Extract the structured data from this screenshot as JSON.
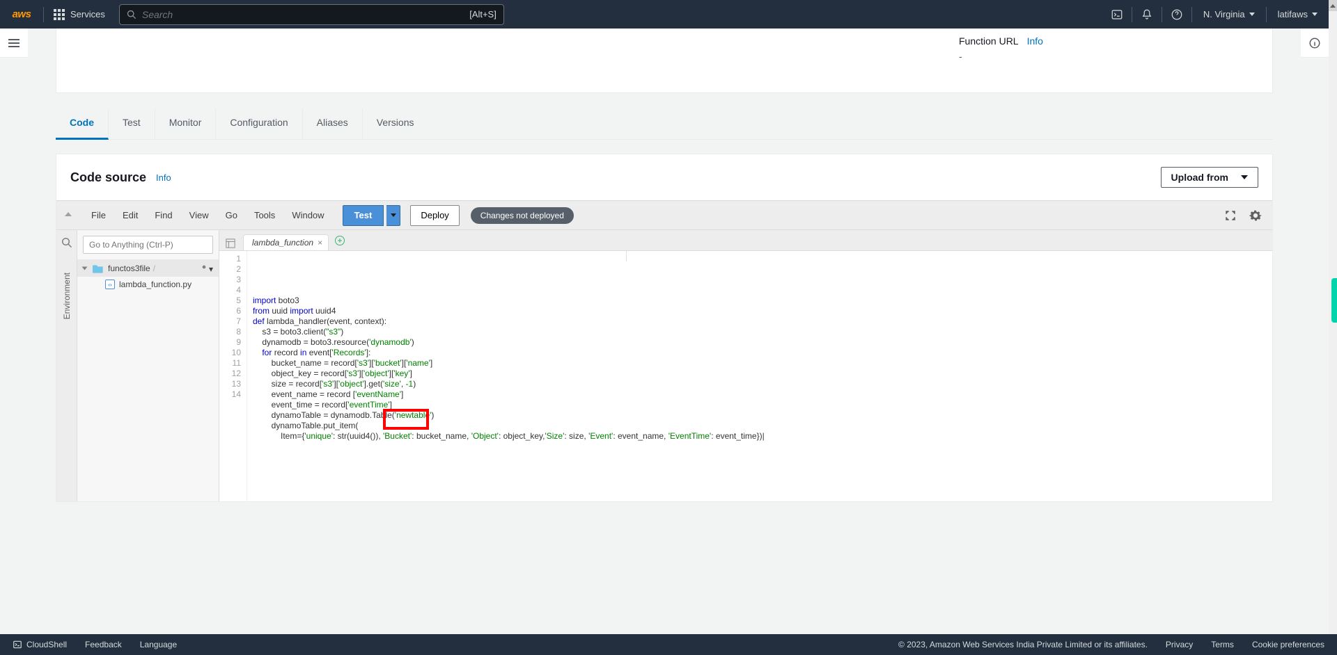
{
  "topnav": {
    "logo": "aws",
    "services": "Services",
    "search_placeholder": "Search",
    "search_shortcut": "[Alt+S]",
    "region": "N. Virginia",
    "user": "latifaws"
  },
  "function_url": {
    "label": "Function URL",
    "info": "Info",
    "value": "-"
  },
  "tabs": [
    "Code",
    "Test",
    "Monitor",
    "Configuration",
    "Aliases",
    "Versions"
  ],
  "active_tab": "Code",
  "code_source": {
    "title": "Code source",
    "info": "Info",
    "upload": "Upload from"
  },
  "ide_menu": [
    "File",
    "Edit",
    "Find",
    "View",
    "Go",
    "Tools",
    "Window"
  ],
  "ide_buttons": {
    "test": "Test",
    "deploy": "Deploy",
    "status": "Changes not deployed"
  },
  "ide_sidebar": {
    "goto_placeholder": "Go to Anything (Ctrl-P)",
    "env_label": "Environment",
    "root": "functos3file",
    "file": "lambda_function.py"
  },
  "editor_tab": "lambda_function",
  "code_lines": [
    {
      "n": 1,
      "html": "<span class='kw'>import</span> boto3"
    },
    {
      "n": 2,
      "html": "<span class='kw'>from</span> uuid <span class='kw'>import</span> uuid4"
    },
    {
      "n": 3,
      "html": "<span class='kw'>def</span> lambda_handler(event, context):"
    },
    {
      "n": 4,
      "html": "    s3 = boto3.client(<span class='str'>\"s3\"</span>)"
    },
    {
      "n": 5,
      "html": "    dynamodb = boto3.resource(<span class='str'>'dynamodb'</span>)"
    },
    {
      "n": 6,
      "html": "    <span class='kw'>for</span> record <span class='kw'>in</span> event[<span class='str'>'Records'</span>]:"
    },
    {
      "n": 7,
      "html": "        bucket_name = record[<span class='str'>'s3'</span>][<span class='str'>'bucket'</span>][<span class='str'>'name'</span>]"
    },
    {
      "n": 8,
      "html": "        object_key = record[<span class='str'>'s3'</span>][<span class='str'>'object'</span>][<span class='str'>'key'</span>]"
    },
    {
      "n": 9,
      "html": "        size = record[<span class='str'>'s3'</span>][<span class='str'>'object'</span>].get(<span class='str'>'size'</span>, <span class='num'>-1</span>)"
    },
    {
      "n": 10,
      "html": "        event_name = record [<span class='str'>'eventName'</span>]"
    },
    {
      "n": 11,
      "html": "        event_time = record[<span class='str'>'eventTime'</span>]"
    },
    {
      "n": 12,
      "html": "        dynamoTable = dynamodb.Table(<span class='str'>'newtable'</span>)"
    },
    {
      "n": 13,
      "html": "        dynamoTable.put_item("
    },
    {
      "n": 14,
      "html": "            Item={<span class='str'>'unique'</span>: str(uuid4()), <span class='str'>'Bucket'</span>: bucket_name, <span class='str'>'Object'</span>: object_key,<span class='str'>'Size'</span>: size, <span class='str'>'Event'</span>: event_name, <span class='str'>'EventTime'</span>: event_time})|"
    }
  ],
  "footer": {
    "cloudshell": "CloudShell",
    "feedback": "Feedback",
    "language": "Language",
    "copyright": "© 2023, Amazon Web Services India Private Limited or its affiliates.",
    "privacy": "Privacy",
    "terms": "Terms",
    "cookies": "Cookie preferences"
  }
}
